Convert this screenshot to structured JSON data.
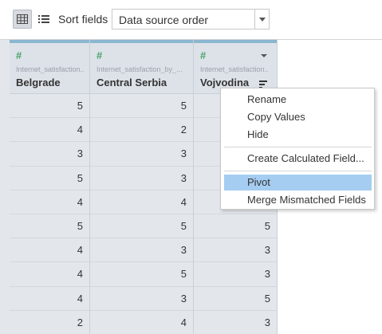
{
  "toolbar": {
    "grid_view_icon": "grid-icon",
    "list_view_icon": "list-icon",
    "sort_label": "Sort fields",
    "sort_value": "Data source order"
  },
  "columns": [
    {
      "type_icon": "#",
      "source": "Internet_satisfaction...",
      "name": "Belgrade"
    },
    {
      "type_icon": "#",
      "source": "Internet_satisfaction_by_...",
      "name": "Central Serbia"
    },
    {
      "type_icon": "#",
      "source": "Internet_satisfaction...",
      "name": "Vojvodina"
    }
  ],
  "rows": [
    [
      "5",
      "5",
      ""
    ],
    [
      "4",
      "2",
      ""
    ],
    [
      "3",
      "3",
      ""
    ],
    [
      "5",
      "3",
      ""
    ],
    [
      "4",
      "4",
      ""
    ],
    [
      "5",
      "5",
      "5"
    ],
    [
      "4",
      "3",
      "3"
    ],
    [
      "4",
      "5",
      "3"
    ],
    [
      "4",
      "3",
      "5"
    ],
    [
      "2",
      "4",
      "3"
    ]
  ],
  "menu": {
    "items": [
      "Rename",
      "Copy Values",
      "Hide",
      "Create Calculated Field...",
      "Pivot",
      "Merge Mismatched Fields"
    ],
    "highlighted": "Pivot"
  },
  "colors": {
    "accent_bar": "#8ab6cf",
    "number_type": "#4aa46b",
    "menu_highlight": "#a5cdf1"
  }
}
